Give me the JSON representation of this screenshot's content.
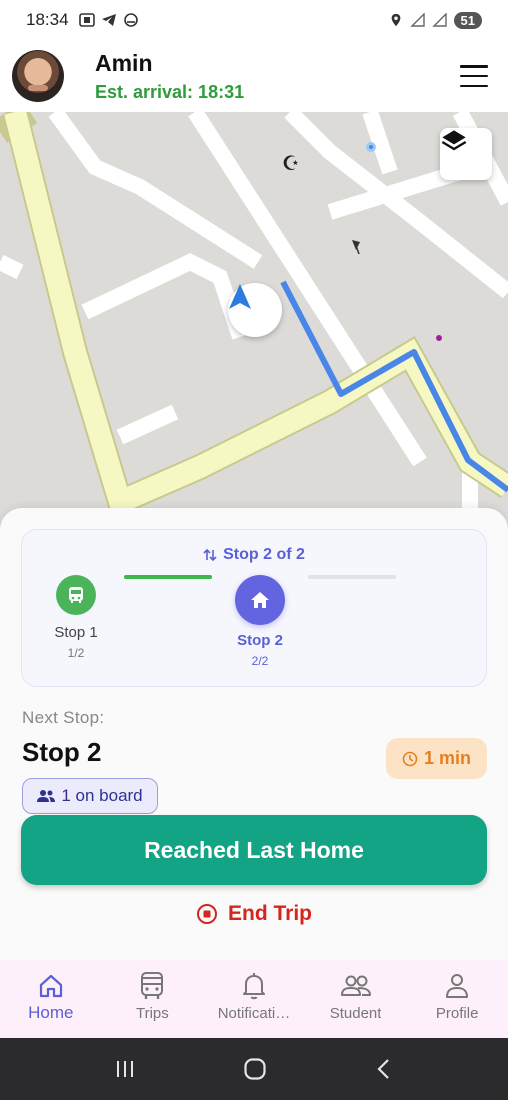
{
  "status_bar": {
    "time": "18:34",
    "battery": "51"
  },
  "header": {
    "driver_name": "Amin",
    "eta": "Est. arrival: 18:31"
  },
  "map": {
    "route_color": "#4a86e8"
  },
  "trip": {
    "stop_counter": "Stop 2 of 2",
    "stops": [
      {
        "label": "Stop 1",
        "sub": "1/2",
        "icon": "bus-icon",
        "status": "completed"
      },
      {
        "label": "Stop 2",
        "sub": "2/2",
        "icon": "home-icon",
        "status": "current"
      }
    ],
    "next_label": "Next Stop:",
    "next_stop": "Stop 2",
    "time_badge": "1 min",
    "on_board": "1 on board",
    "primary_action": "Reached Last Home",
    "end_trip": "End Trip"
  },
  "bottom_nav": {
    "items": [
      {
        "label": "Home",
        "icon": "home-icon",
        "active": true
      },
      {
        "label": "Trips",
        "icon": "bus-icon",
        "active": false
      },
      {
        "label": "Notificati…",
        "icon": "bell-icon",
        "active": false
      },
      {
        "label": "Student",
        "icon": "people-icon",
        "active": false
      },
      {
        "label": "Profile",
        "icon": "person-icon",
        "active": false
      }
    ]
  },
  "colors": {
    "accent": "#5a60d8",
    "success": "#3fb64a",
    "primary_button": "#12a484",
    "danger": "#d3261e",
    "warning": "#e5801f"
  }
}
